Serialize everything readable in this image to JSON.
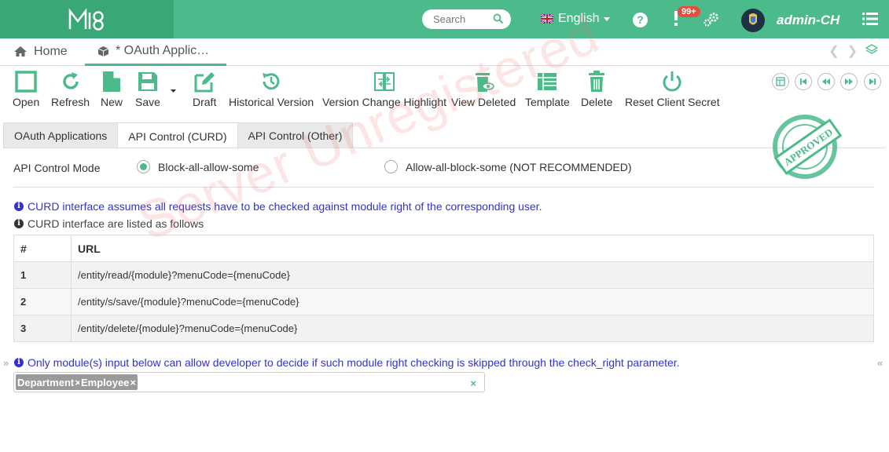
{
  "header": {
    "search_placeholder": "Search",
    "language": "English",
    "notification_badge": "99+",
    "username": "admin-CH",
    "brand_color": "#4cbb8c"
  },
  "tabs": {
    "home": "Home",
    "active": "* OAuth Applic…"
  },
  "toolbar": {
    "open": "Open",
    "refresh": "Refresh",
    "new": "New",
    "save": "Save",
    "draft": "Draft",
    "historical_version": "Historical Version",
    "version_change_highlight": "Version Change Highlight",
    "view_deleted": "View Deleted",
    "template": "Template",
    "delete": "Delete",
    "reset_client_secret": "Reset Client Secret"
  },
  "watermark": "Server Unregistered",
  "stamp": "APPROVED",
  "subtabs": [
    "OAuth Applications",
    "API Control (CURD)",
    "API Control (Other)"
  ],
  "form": {
    "mode_label": "API Control Mode",
    "option_1": "Block-all-allow-some",
    "option_2": "Allow-all-block-some (NOT RECOMMENDED)",
    "selected": "Block-all-allow-some"
  },
  "notes": {
    "note_1": "CURD interface assumes all requests have to be checked against module right of the corresponding user.",
    "note_2": "CURD interface are listed as follows",
    "note_3": "Only module(s) input below can allow developer to decide if such module right checking is skipped through the check_right parameter."
  },
  "table": {
    "headers": [
      "#",
      "URL"
    ],
    "rows": [
      {
        "num": "1",
        "url": "/entity/read/{module}?menuCode={menuCode}"
      },
      {
        "num": "2",
        "url": "/entity/s/save/{module}?menuCode={menuCode}"
      },
      {
        "num": "3",
        "url": "/entity/delete/{module}?menuCode={menuCode}"
      }
    ]
  },
  "tags": [
    "Department",
    "Employee"
  ]
}
